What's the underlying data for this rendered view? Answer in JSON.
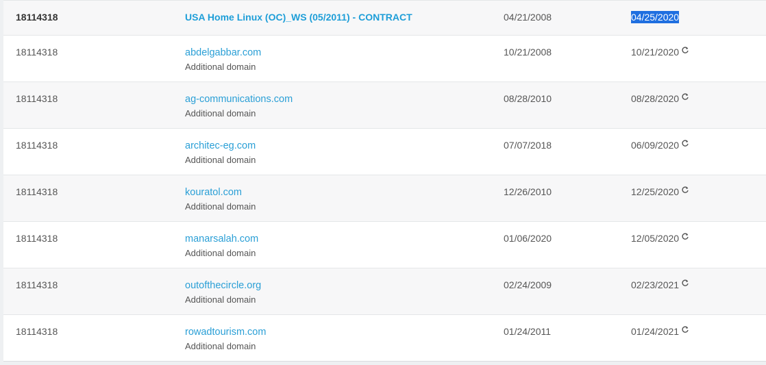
{
  "main_row": {
    "id": "18114318",
    "name": "USA Home Linux (OC)_WS (05/2011) - CONTRACT",
    "start_date": "04/21/2008",
    "end_date": "04/25/2020"
  },
  "rows": [
    {
      "id": "18114318",
      "domain": "abdelgabbar.com",
      "type": "Additional domain",
      "start_date": "10/21/2008",
      "end_date": "10/21/2020"
    },
    {
      "id": "18114318",
      "domain": "ag-communications.com",
      "type": "Additional domain",
      "start_date": "08/28/2010",
      "end_date": "08/28/2020"
    },
    {
      "id": "18114318",
      "domain": "architec-eg.com",
      "type": "Additional domain",
      "start_date": "07/07/2018",
      "end_date": "06/09/2020"
    },
    {
      "id": "18114318",
      "domain": "kouratol.com",
      "type": "Additional domain",
      "start_date": "12/26/2010",
      "end_date": "12/25/2020"
    },
    {
      "id": "18114318",
      "domain": "manarsalah.com",
      "type": "Additional domain",
      "start_date": "01/06/2020",
      "end_date": "12/05/2020"
    },
    {
      "id": "18114318",
      "domain": "outofthecircle.org",
      "type": "Additional domain",
      "start_date": "02/24/2009",
      "end_date": "02/23/2021"
    },
    {
      "id": "18114318",
      "domain": "rowadtourism.com",
      "type": "Additional domain",
      "start_date": "01/24/2011",
      "end_date": "01/24/2021"
    }
  ],
  "icons": {
    "renew": "auto-renew-icon"
  },
  "colors": {
    "link": "#2a9fd6",
    "selection": "#1f6fe0",
    "shaded_row": "#f7f7f8"
  }
}
